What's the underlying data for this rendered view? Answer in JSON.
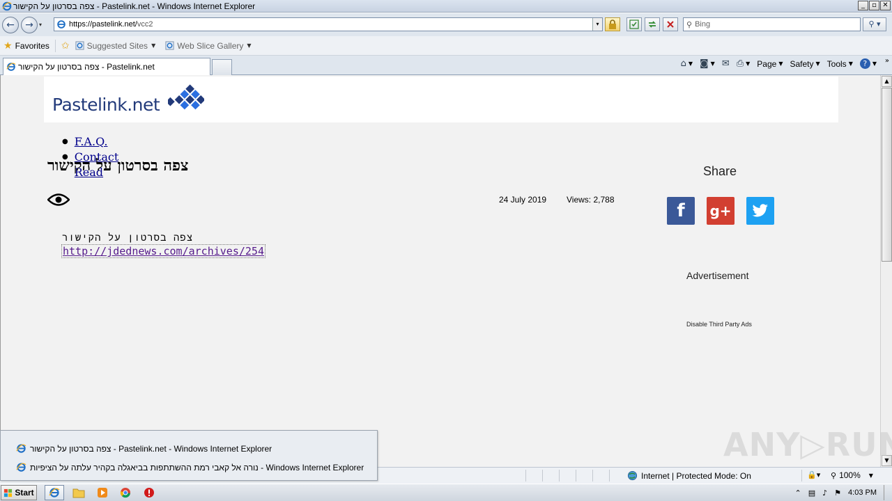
{
  "window": {
    "title": "צפה בסרטון על הקישור - Pastelink.net - Windows Internet Explorer",
    "min_glyph": "_",
    "max_glyph": "▫",
    "close_glyph": "✕"
  },
  "address_bar": {
    "back_glyph": "←",
    "forward_glyph": "→",
    "dropdown_glyph": "▾",
    "url_host": "https://pastelink.net/",
    "url_path": "vcc2",
    "search_placeholder": "Bing",
    "search_glyph": "⚲",
    "search_go": "⚲ ▾"
  },
  "favorites_bar": {
    "favorites_label": "Favorites",
    "items": [
      {
        "label": "Suggested Sites"
      },
      {
        "label": "Web Slice Gallery"
      }
    ]
  },
  "tabs": [
    {
      "label": "צפה בסרטון על הקישור - Pastelink.net"
    }
  ],
  "command_bar": {
    "page": "Page",
    "safety": "Safety",
    "tools": "Tools",
    "help": "?"
  },
  "site": {
    "logo_text": "Pastelink",
    "logo_suffix": ".net",
    "nav": [
      "F.A.Q.",
      "Contact",
      "Read"
    ],
    "heading": "צפה בסרטון על הקישור",
    "date": "24 July 2019",
    "views": "Views: 2,788",
    "paste_text": "צפה בסרטון על הקישור",
    "paste_link": "http://jdednews.com/archives/254",
    "share_title": "Share",
    "ad_title": "Advertisement",
    "ad_disable": "Disable Third Party Ads"
  },
  "status_bar": {
    "zone": "Internet | Protected Mode: On",
    "zoom": "100%"
  },
  "taskbar_popup": [
    {
      "label": "צפה בסרטון על הקישור - Pastelink.net - Windows Internet Explorer"
    },
    {
      "label": "נורה אל קאבי רמת ההשתתפות בביאגלה בקהיר עלתה על הציפיות - Windows Internet Explorer"
    }
  ],
  "taskbar": {
    "start": "Start",
    "clock": "4:03 PM"
  },
  "watermark": "ANY▷RUN",
  "colors": {
    "logo_blue": "#223a7a",
    "facebook": "#3b5998",
    "googleplus": "#d23f31",
    "twitter": "#1da1f2",
    "link": "#551a8b"
  }
}
